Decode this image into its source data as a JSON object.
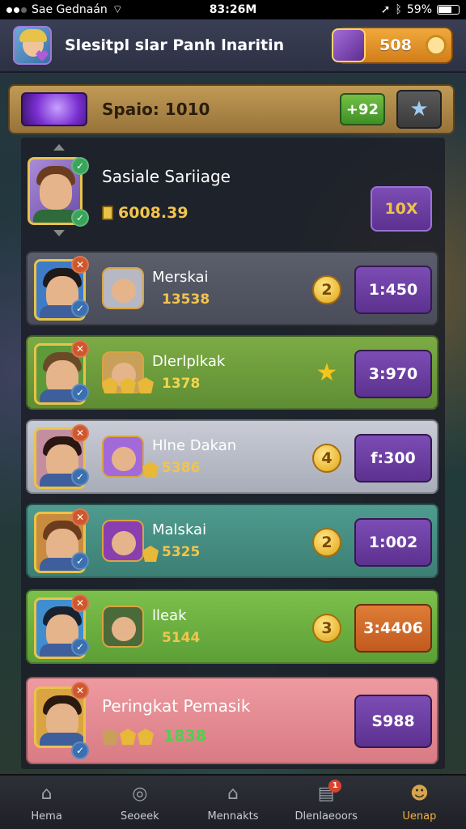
{
  "status": {
    "carrier": "Sae Gednaán",
    "time": "83:26M",
    "battery": "59%"
  },
  "header": {
    "title": "Slesitpl slar Panh lnaritin",
    "coins": "508"
  },
  "panel": {
    "title": "Spaio: 1010",
    "score": "+92"
  },
  "top_card": {
    "name": "Sasiale Sariiage",
    "points": "6008.39",
    "multiplier": "10X"
  },
  "rows": [
    {
      "name": "Merskai",
      "points": "13538",
      "rank": "2",
      "value": "1:450",
      "bg": "#5b5e6b",
      "bg2": "#4a4d59"
    },
    {
      "name": "Dlerlplkak",
      "points": "1378",
      "rank": "★",
      "value": "3:970",
      "bg": "#7cab45",
      "bg2": "#5f8d33"
    },
    {
      "name": "Hlne Dakan",
      "points": "5386",
      "rank": "4",
      "value": "f:300",
      "bg": "#c9ccd6",
      "bg2": "#a9adb9"
    },
    {
      "name": "Malskai",
      "points": "5325",
      "rank": "2",
      "value": "1:002",
      "bg": "#4f9b8f",
      "bg2": "#3c7f74"
    },
    {
      "name": "lleak",
      "points": "5144",
      "rank": "3",
      "value": "3:4406",
      "bg": "#7dc04c",
      "bg2": "#5c9f36"
    },
    {
      "name": "Peringkat Pemasik",
      "points": "1838",
      "rank": "",
      "value": "S988",
      "bg": "#ee9aa0",
      "bg2": "#d97b84"
    }
  ],
  "tabs": [
    {
      "label": "Hema",
      "icon": "home-icon"
    },
    {
      "label": "Seoeek",
      "icon": "search-icon"
    },
    {
      "label": "Mennakts",
      "icon": "market-icon"
    },
    {
      "label": "Dlenlaeoors",
      "icon": "inbox-icon"
    },
    {
      "label": "Uenap",
      "icon": "profile-icon"
    }
  ],
  "colors": {
    "accent": "#f2b33e",
    "panel": "#c09a55",
    "value_purple": "#6b3fa3",
    "value_orange": "#d2692b"
  }
}
